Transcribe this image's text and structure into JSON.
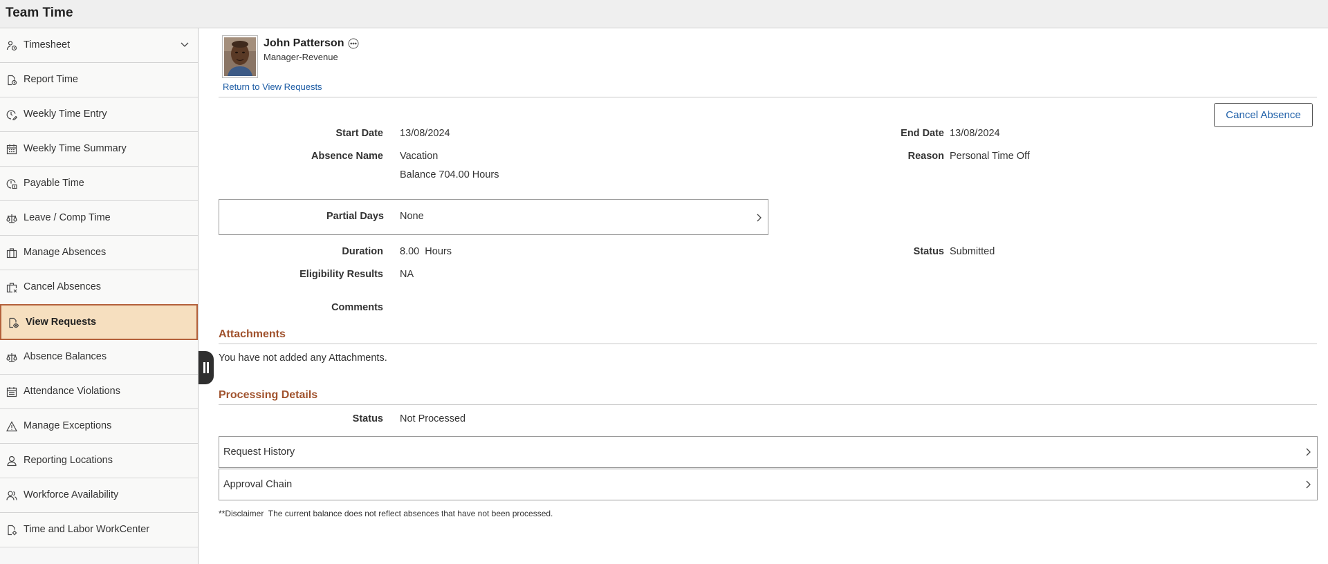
{
  "app": {
    "title": "Team Time"
  },
  "sidebar": {
    "items": [
      {
        "label": "Timesheet",
        "icon": "person-clock-icon",
        "has_chevron": true
      },
      {
        "label": "Report Time",
        "icon": "document-clock-icon"
      },
      {
        "label": "Weekly Time Entry",
        "icon": "clock-pencil-icon"
      },
      {
        "label": "Weekly Time Summary",
        "icon": "calendar-grid-icon"
      },
      {
        "label": "Payable Time",
        "icon": "clock-money-icon"
      },
      {
        "label": "Leave / Comp Time",
        "icon": "scale-icon"
      },
      {
        "label": "Manage Absences",
        "icon": "briefcase-icon"
      },
      {
        "label": "Cancel Absences",
        "icon": "briefcase-cancel-icon"
      },
      {
        "label": "View Requests",
        "icon": "document-view-icon",
        "active": true
      },
      {
        "label": "Absence Balances",
        "icon": "scale-icon"
      },
      {
        "label": "Attendance Violations",
        "icon": "calendar-icon"
      },
      {
        "label": "Manage Exceptions",
        "icon": "warning-icon"
      },
      {
        "label": "Reporting Locations",
        "icon": "person-location-icon"
      },
      {
        "label": "Workforce Availability",
        "icon": "people-icon"
      },
      {
        "label": "Time and Labor WorkCenter",
        "icon": "document-gear-icon"
      }
    ],
    "active_color": "#f6dfbf",
    "active_border": "#b3603b"
  },
  "person": {
    "name": "John Patterson",
    "title": "Manager-Revenue",
    "return_link": "Return to View Requests"
  },
  "actions": {
    "cancel_absence": "Cancel Absence"
  },
  "details": {
    "start_date_label": "Start Date",
    "start_date": "13/08/2024",
    "end_date_label": "End Date",
    "end_date": "13/08/2024",
    "absence_name_label": "Absence Name",
    "absence_name": "Vacation",
    "balance": "Balance 704.00 Hours",
    "reason_label": "Reason",
    "reason": "Personal Time Off",
    "partial_days_label": "Partial Days",
    "partial_days": "None",
    "duration_label": "Duration",
    "duration": "8.00  Hours",
    "status_label": "Status",
    "status": "Submitted",
    "eligibility_label": "Eligibility Results",
    "eligibility": "NA",
    "comments_label": "Comments"
  },
  "attachments": {
    "title": "Attachments",
    "empty_text": "You have not added any Attachments."
  },
  "processing": {
    "title": "Processing Details",
    "status_label": "Status",
    "status": "Not Processed",
    "request_history": "Request History",
    "approval_chain": "Approval Chain"
  },
  "disclaimer": "**Disclaimer  The current balance does not reflect absences that have not been processed.",
  "colors": {
    "section_title": "#a0522d",
    "link": "#1a5aa3"
  }
}
